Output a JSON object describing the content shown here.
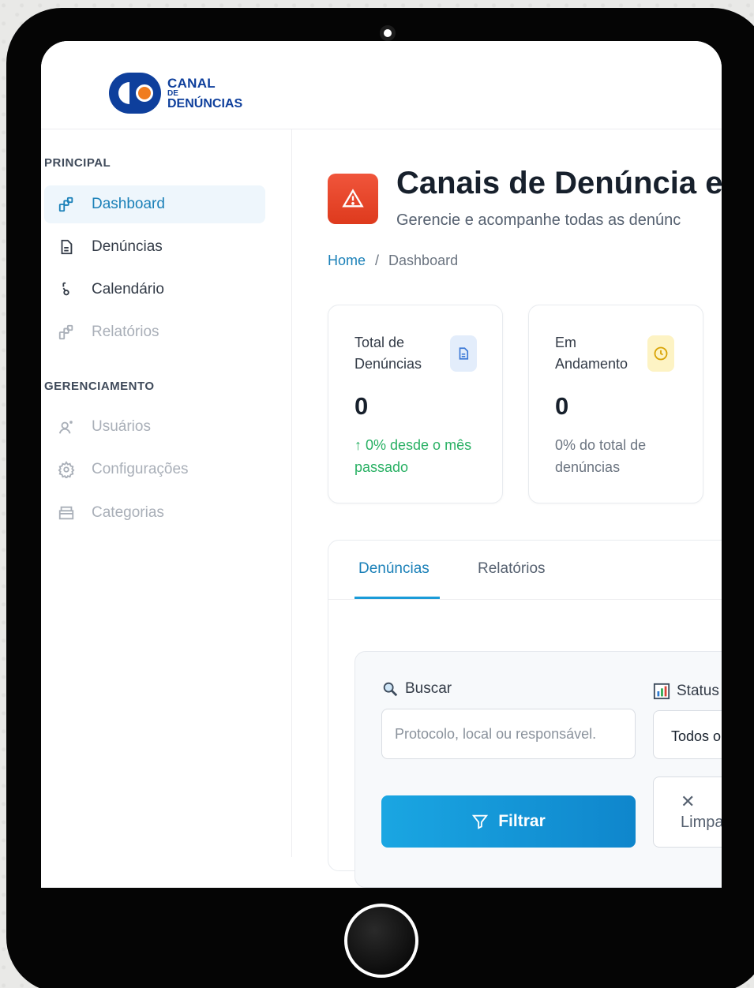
{
  "logo": {
    "line1": "CANAL",
    "line2": "DE",
    "line3": "DENÚNCIAS"
  },
  "sidebar": {
    "section_principal": "PRINCIPAL",
    "section_gerenciamento": "GERENCIAMENTO",
    "items": [
      {
        "label": "Dashboard",
        "icon": "dashboard-icon",
        "state": "active"
      },
      {
        "label": "Denúncias",
        "icon": "document-icon",
        "state": "normal"
      },
      {
        "label": "Calendário",
        "icon": "calendar-icon",
        "state": "normal"
      },
      {
        "label": "Relatórios",
        "icon": "reports-icon",
        "state": "disabled"
      },
      {
        "label": "Usuários",
        "icon": "users-icon",
        "state": "disabled"
      },
      {
        "label": "Configurações",
        "icon": "gear-icon",
        "state": "disabled"
      },
      {
        "label": "Categorias",
        "icon": "folder-icon",
        "state": "disabled"
      }
    ]
  },
  "header": {
    "title": "Canais de Denúncia e",
    "subtitle": "Gerencie e acompanhe todas as denúnc",
    "breadcrumb": {
      "home": "Home",
      "separator": "/",
      "current": "Dashboard"
    }
  },
  "cards": [
    {
      "label": "Total de Denúncias",
      "value": "0",
      "note": "↑ 0% desde o mês passado",
      "icon": "document-icon",
      "icon_bg": "#e3edfb",
      "icon_color": "#3b78d6"
    },
    {
      "label": "Em Andamento",
      "value": "0",
      "note": "0% do total de denúncias",
      "icon": "clock-icon",
      "icon_bg": "#fdf3c4",
      "icon_color": "#d9a406"
    }
  ],
  "tabs": [
    {
      "label": "Denúncias",
      "active": true
    },
    {
      "label": "Relatórios",
      "active": false
    }
  ],
  "filters": {
    "search_label": "Buscar",
    "search_placeholder": "Protocolo, local ou responsável.",
    "status_label": "Status",
    "status_value": "Todos o",
    "filter_button": "Filtrar",
    "clear_button": "Limpa"
  },
  "colors": {
    "accent": "#1a80b8",
    "title_icon": "#e8462a",
    "positive": "#28b063",
    "logo_blue": "#0e3f9c",
    "logo_orange": "#f07c1e"
  }
}
